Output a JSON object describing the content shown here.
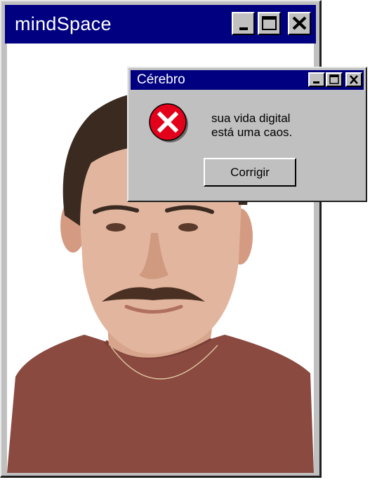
{
  "main_window": {
    "title": "mindSpace",
    "controls": {
      "minimize_icon": "minimize-icon",
      "maximize_icon": "maximize-icon",
      "close_icon": "close-icon"
    }
  },
  "dialog": {
    "title": "Cérebro",
    "message_lines": [
      "sua vida digital",
      "está uma caos."
    ],
    "button_label": "Corrigir",
    "icon": "error-icon",
    "controls": {
      "minimize_icon": "minimize-icon",
      "maximize_icon": "maximize-icon",
      "close_icon": "close-icon"
    }
  },
  "colors": {
    "titlebar": "#000080",
    "window_face": "#c0c0c0",
    "error_red": "#e3001b",
    "shirt": "#8a4a40"
  }
}
